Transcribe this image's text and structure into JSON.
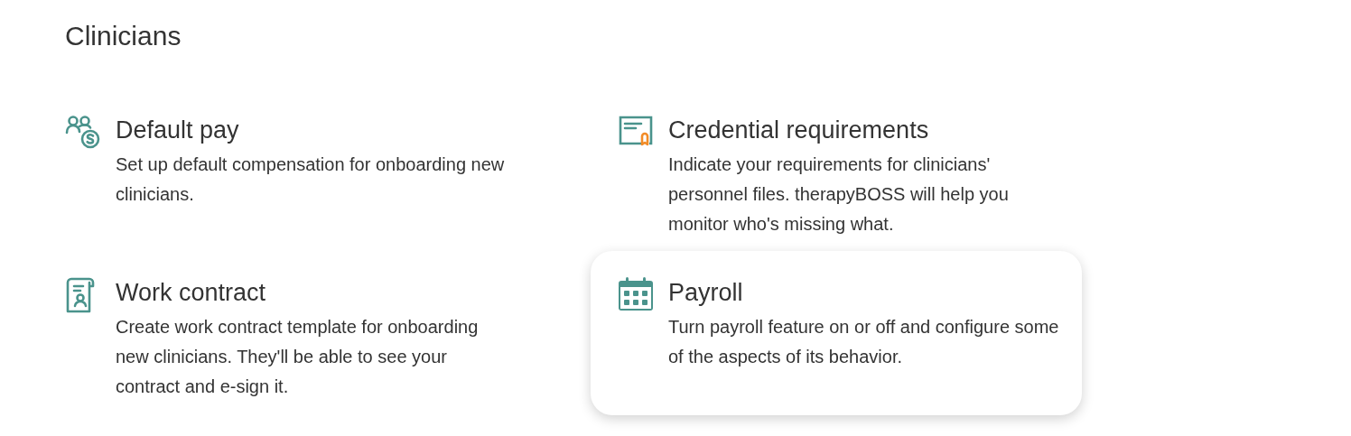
{
  "section": {
    "title": "Clinicians"
  },
  "items": [
    {
      "title": "Default pay",
      "description": "Set up default compensation for onboarding new clinicians.",
      "selected": false
    },
    {
      "title": "Credential requirements",
      "description": "Indicate your requirements for clinicians' personnel files. therapyBOSS will help you monitor who's missing what.",
      "selected": false
    },
    {
      "title": "Work contract",
      "description": "Create work contract template for onboarding new clinicians. They'll be able to see your contract and e-sign it.",
      "selected": false
    },
    {
      "title": "Payroll",
      "description": "Turn payroll feature on or off and configure some of the aspects of its behavior.",
      "selected": true
    }
  ]
}
